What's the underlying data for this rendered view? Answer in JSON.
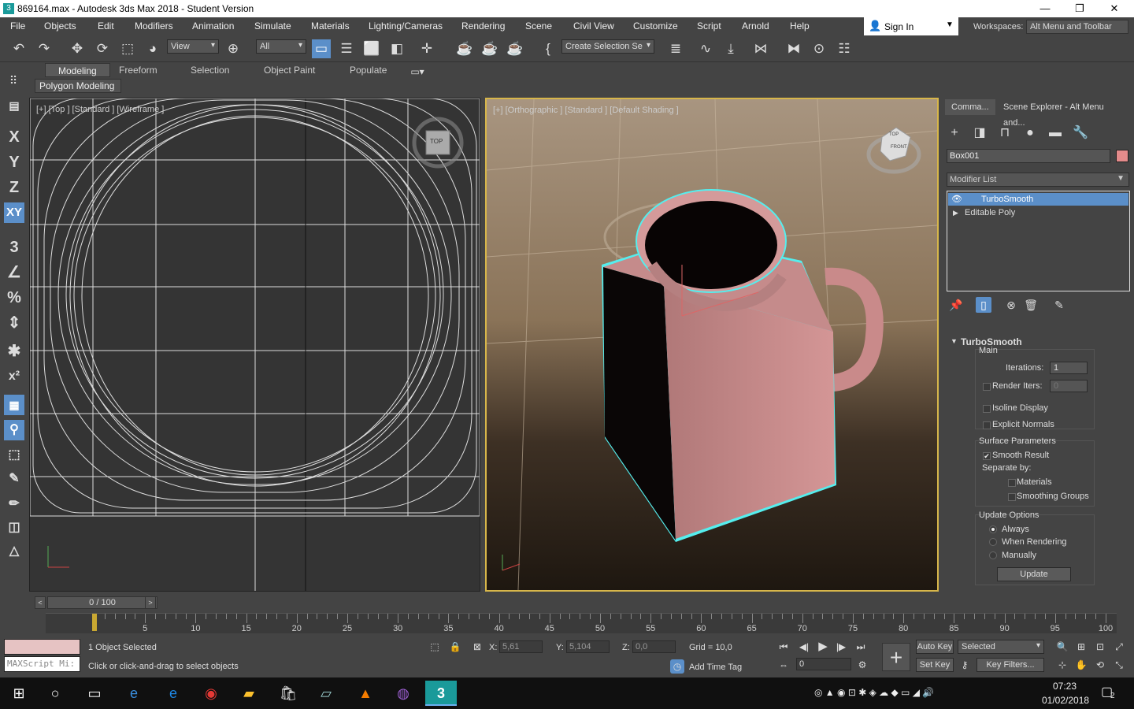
{
  "window": {
    "title": "869164.max - Autodesk 3ds Max 2018 - Student Version",
    "min": "—",
    "max": "❐",
    "close": "✕"
  },
  "menus": [
    "File",
    "Objects",
    "Edit",
    "Modifiers",
    "Animation",
    "Simulate",
    "Materials",
    "Lighting/Cameras",
    "Rendering",
    "Scene",
    "Civil View",
    "Customize",
    "Script",
    "Arnold",
    "Help"
  ],
  "signin": "Sign In",
  "workspace": {
    "label": "Workspaces:",
    "value": "Alt Menu and Toolbar"
  },
  "toolbar": {
    "view_dd": "View",
    "filter_dd": "All",
    "selection_set": "Create Selection Se"
  },
  "ribbon": {
    "tabs": [
      "Modeling",
      "Freeform",
      "Selection",
      "Object Paint",
      "Populate"
    ],
    "sub": "Polygon Modeling"
  },
  "left_tools": [
    "X",
    "Y",
    "Z",
    "XY"
  ],
  "viewports": {
    "top_label": "[+] [Top ] [Standard ] [Wireframe ]",
    "persp_label": "[+] [Orthographic ] [Standard ] [Default Shading ]",
    "viewcube_top": "TOP",
    "viewcube_front": "FRONT"
  },
  "command_panel": {
    "tabs": [
      "Comma...",
      "Scene Explorer - Alt Menu and..."
    ],
    "object_name": "Box001",
    "object_color": "#e48b8b",
    "modifier_list": "Modifier List",
    "stack": [
      "TurboSmooth",
      "Editable Poly"
    ],
    "rollout": {
      "title": "TurboSmooth",
      "main": "Main",
      "iterations_label": "Iterations:",
      "iterations": "1",
      "render_iters_label": "Render Iters:",
      "render_iters": "0",
      "isoline": "Isoline Display",
      "explicit": "Explicit Normals",
      "surface": "Surface Parameters",
      "smooth_result": "Smooth Result",
      "separate": "Separate by:",
      "materials": "Materials",
      "smoothing_groups": "Smoothing Groups",
      "update_options": "Update Options",
      "always": "Always",
      "when_rendering": "When Rendering",
      "manually": "Manually",
      "update_btn": "Update"
    }
  },
  "timeline": {
    "slider": "0 / 100",
    "ticks": [
      "5",
      "10",
      "15",
      "20",
      "25",
      "30",
      "35",
      "40",
      "45",
      "50",
      "55",
      "60",
      "65",
      "70",
      "75",
      "80",
      "85",
      "90",
      "95",
      "100"
    ]
  },
  "status": {
    "selected": "1 Object Selected",
    "prompt": "Click or click-and-drag to select objects",
    "maxscript": "MAXScript Mi:",
    "x_label": "X:",
    "x": "5,61",
    "y_label": "Y:",
    "y": "5,104",
    "z_label": "Z:",
    "z": "0,0",
    "grid": "Grid = 10,0",
    "add_time_tag": "Add Time Tag",
    "auto_key": "Auto Key",
    "selected_dd": "Selected",
    "set_key": "Set Key",
    "key_filters": "Key Filters...",
    "frame": "0"
  },
  "taskbar": {
    "time": "07:23",
    "date": "01/02/2018",
    "notif": "2"
  }
}
